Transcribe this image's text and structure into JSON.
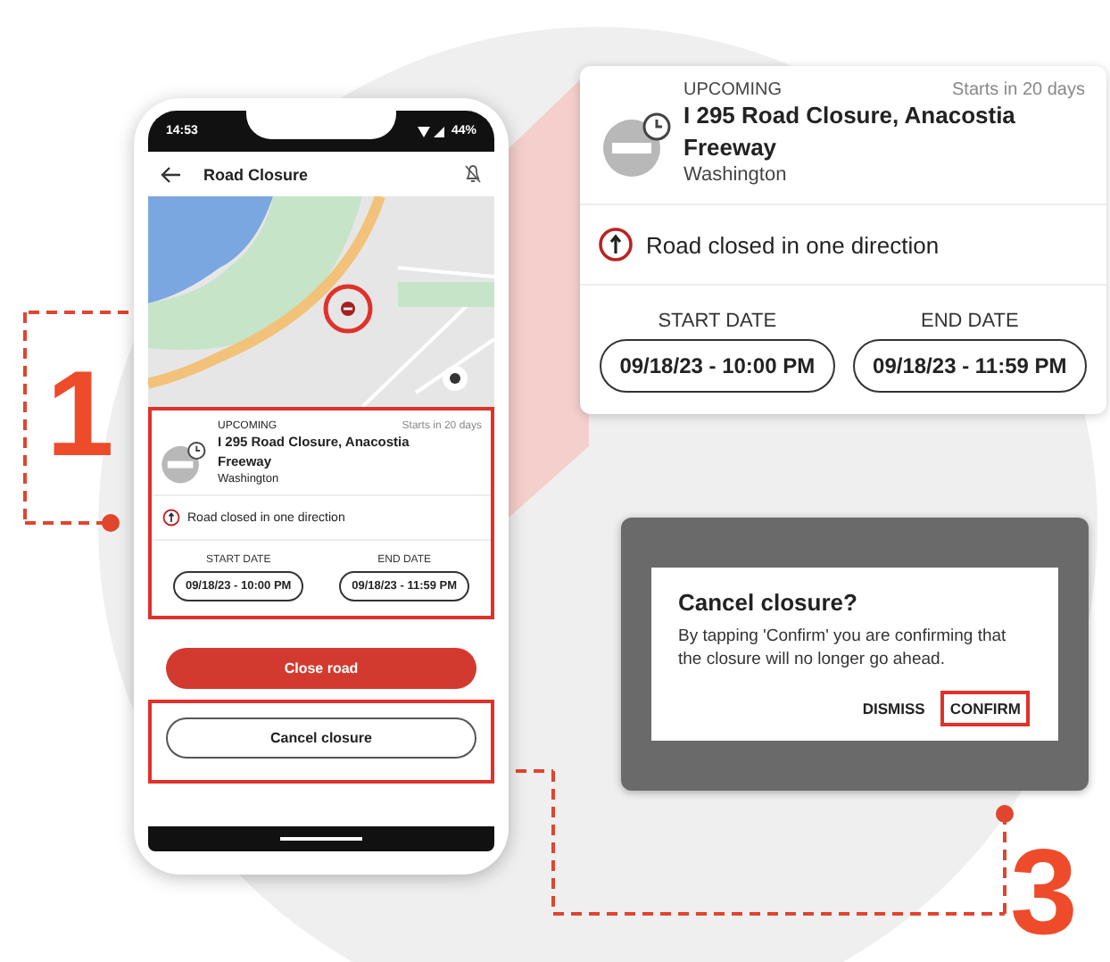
{
  "phone": {
    "status_bar": {
      "time": "14:53",
      "battery": "44%"
    },
    "app_bar": {
      "title": "Road Closure"
    },
    "closure_card": {
      "status": "UPCOMING",
      "starts": "Starts in 20 days",
      "title": "I 295 Road Closure, Anacostia Freeway",
      "location": "Washington",
      "restriction": "Road closed in one direction",
      "start_label": "START DATE",
      "start_value": "09/18/23 - 10:00 PM",
      "end_label": "END DATE",
      "end_value": "09/18/23 - 11:59 PM",
      "highlighted": true
    },
    "buttons": [
      {
        "label": "Close road",
        "kind": "primary",
        "highlighted": false
      },
      {
        "label": "Cancel closure",
        "kind": "outline",
        "highlighted": true
      }
    ]
  },
  "detail_card": {
    "status": "UPCOMING",
    "starts": "Starts in 20 days",
    "title": "I 295 Road Closure, Anacostia Freeway",
    "location": "Washington",
    "restriction": "Road closed in one direction",
    "start_label": "START DATE",
    "start_value": "09/18/23 - 10:00 PM",
    "end_label": "END DATE",
    "end_value": "09/18/23 - 11:59 PM",
    "highlighted": false
  },
  "dialog": {
    "title": "Cancel closure?",
    "message": "By tapping 'Confirm' you are confirming that the closure will no longer go ahead.",
    "actions": [
      {
        "label": "DISMISS",
        "highlighted": false
      },
      {
        "label": "CONFIRM",
        "highlighted": true
      }
    ]
  },
  "callouts": [
    {
      "number": "1"
    },
    {
      "number": "3"
    }
  ]
}
